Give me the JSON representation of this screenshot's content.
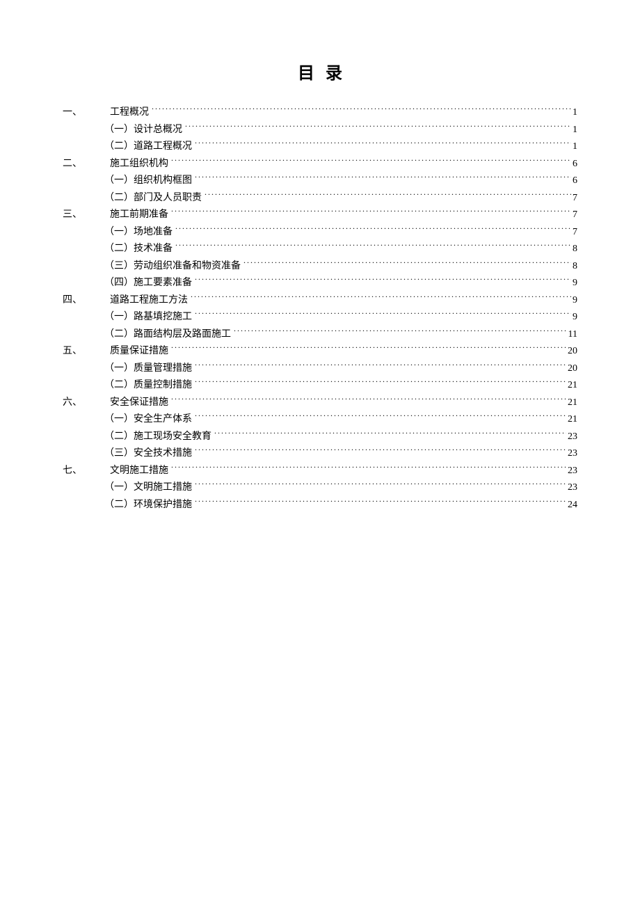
{
  "title": "目录",
  "entries": [
    {
      "level": 1,
      "num": "一、",
      "label": "工程概况",
      "page": "1"
    },
    {
      "level": 2,
      "num": "",
      "label": "（一）设计总概况",
      "page": "1"
    },
    {
      "level": 2,
      "num": "",
      "label": "（二）道路工程概况",
      "page": "1"
    },
    {
      "level": 1,
      "num": "二、",
      "label": "施工组织机构",
      "page": "6"
    },
    {
      "level": 2,
      "num": "",
      "label": "（一）组织机构框图",
      "page": "6"
    },
    {
      "level": 2,
      "num": "",
      "label": "（二）部门及人员职责",
      "page": "7"
    },
    {
      "level": 1,
      "num": "三、",
      "label": "施工前期准备",
      "page": "7"
    },
    {
      "level": 2,
      "num": "",
      "label": "（一）场地准备",
      "page": "7"
    },
    {
      "level": 2,
      "num": "",
      "label": "（二）技术准备",
      "page": "8"
    },
    {
      "level": 2,
      "num": "",
      "label": "（三）劳动组织准备和物资准备",
      "page": "8"
    },
    {
      "level": 2,
      "num": "",
      "label": "（四）施工要素准备",
      "page": "9"
    },
    {
      "level": 1,
      "num": "四、",
      "label": "道路工程施工方法",
      "page": "9"
    },
    {
      "level": 2,
      "num": "",
      "label": "（一）路基填挖施工",
      "page": "9"
    },
    {
      "level": 2,
      "num": "",
      "label": "（二）路面结构层及路面施工",
      "page": "11"
    },
    {
      "level": 1,
      "num": "五、",
      "label": "质量保证措施",
      "page": "20"
    },
    {
      "level": 2,
      "num": "",
      "label": "（一）质量管理措施",
      "page": "20"
    },
    {
      "level": 2,
      "num": "",
      "label": "（二）质量控制措施",
      "page": "21"
    },
    {
      "level": 1,
      "num": "六、",
      "label": "安全保证措施",
      "page": "21"
    },
    {
      "level": 2,
      "num": "",
      "label": "（一）安全生产体系",
      "page": "21"
    },
    {
      "level": 2,
      "num": "",
      "label": "（二）施工现场安全教育",
      "page": "23"
    },
    {
      "level": 2,
      "num": "",
      "label": "（三）安全技术措施",
      "page": "23"
    },
    {
      "level": 1,
      "num": "七、",
      "label": "文明施工措施",
      "page": "23"
    },
    {
      "level": 2,
      "num": "",
      "label": "（一）文明施工措施",
      "page": "23"
    },
    {
      "level": 2,
      "num": "",
      "label": "（二）环境保护措施",
      "page": "24"
    }
  ]
}
